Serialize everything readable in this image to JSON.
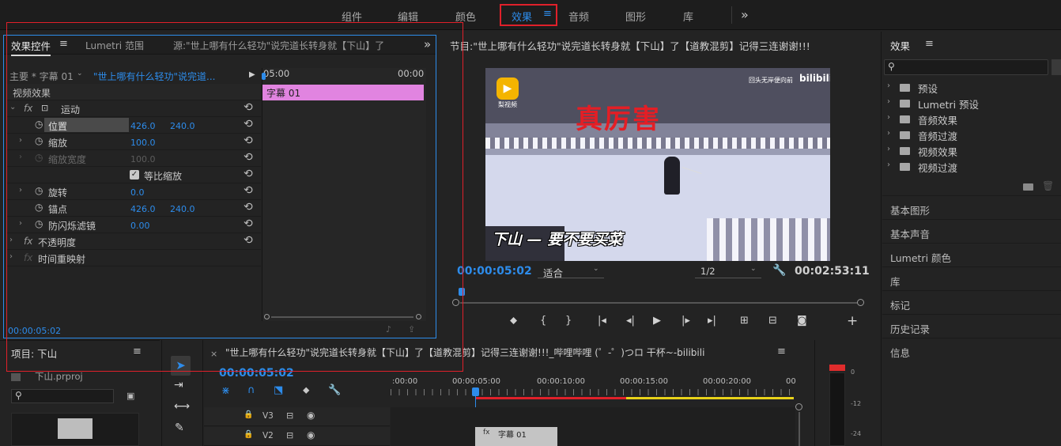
{
  "workspace_tabs": [
    "组件",
    "编辑",
    "颜色",
    "效果",
    "音频",
    "图形",
    "库"
  ],
  "workspace_more": "»",
  "effect_controls": {
    "tab_label": "效果控件",
    "tab_menu": "≡",
    "lumetri_tab": "Lumetri 范围",
    "source_tab": "源:\"世上哪有什么轻功\"说完道长转身就【下山】了",
    "more": "»",
    "master_label": "主要 * 字幕 01",
    "clip_label": "\"世上哪有什么轻功\"说完道...",
    "video_effects": "视频效果",
    "fx": "fx",
    "motion": "运动",
    "position": "位置",
    "position_x": "426.0",
    "position_y": "240.0",
    "scale": "缩放",
    "scale_val": "100.0",
    "scale_width": "缩放宽度",
    "scale_width_val": "100.0",
    "uniform_scale": "等比缩放",
    "rotation": "旋转",
    "rotation_val": "0.0",
    "anchor": "锚点",
    "anchor_x": "426.0",
    "anchor_y": "240.0",
    "antiflicker": "防闪烁滤镜",
    "antiflicker_val": "0.00",
    "opacity": "不透明度",
    "time_remap": "时间重映射",
    "mini_time_start": "05:00",
    "mini_time_end": "00:00",
    "clip_name": "字幕 01",
    "current_time": "00:00:05:02"
  },
  "program_monitor": {
    "title": "节目:\"世上哪有什么轻功\"说完道长转身就【下山】了【道教混剪】记得三连谢谢!!!",
    "more": "»",
    "video_logo_text": "梨视频",
    "video_corner_text": "回头无岸便向前",
    "video_brand": "bilibili",
    "video_headline": "真厉害",
    "video_subtitle": "下山 — 要不要买菜",
    "timecode": "00:00:05:02",
    "fit_option": "适合",
    "resolution_option": "1/2",
    "duration": "00:02:53:11"
  },
  "effects_panel": {
    "title": "效果",
    "menu": "≡",
    "folders": [
      "预设",
      "Lumetri 预设",
      "音频效果",
      "音频过渡",
      "视频效果",
      "视频过渡"
    ],
    "sections": [
      "基本图形",
      "基本声音",
      "Lumetri 颜色",
      "库",
      "标记",
      "历史记录",
      "信息"
    ]
  },
  "project_panel": {
    "title": "项目: 下山",
    "menu": "≡",
    "file_name": "下山.prproj"
  },
  "timeline": {
    "close": "×",
    "title": "\"世上哪有什么轻功\"说完道长转身就【下山】了【道教混剪】记得三连谢谢!!!_哔哩哔哩 (゜-゜)つロ 干杯~-bilibili",
    "menu": "≡",
    "timecode": "00:00:05:02",
    "ruler": [
      ":00:00",
      "00:00:05:00",
      "00:00:10:00",
      "00:00:15:00",
      "00:00:20:00",
      "00"
    ],
    "tracks": [
      "V3",
      "V2"
    ],
    "clip_label": "字幕 01"
  },
  "audio_meter": {
    "labels": [
      "0",
      "-12",
      "-24"
    ]
  },
  "colors": {
    "accent": "#2d8ceb",
    "highlight_box": "#e0202a",
    "clip_pink": "#e184e0"
  }
}
